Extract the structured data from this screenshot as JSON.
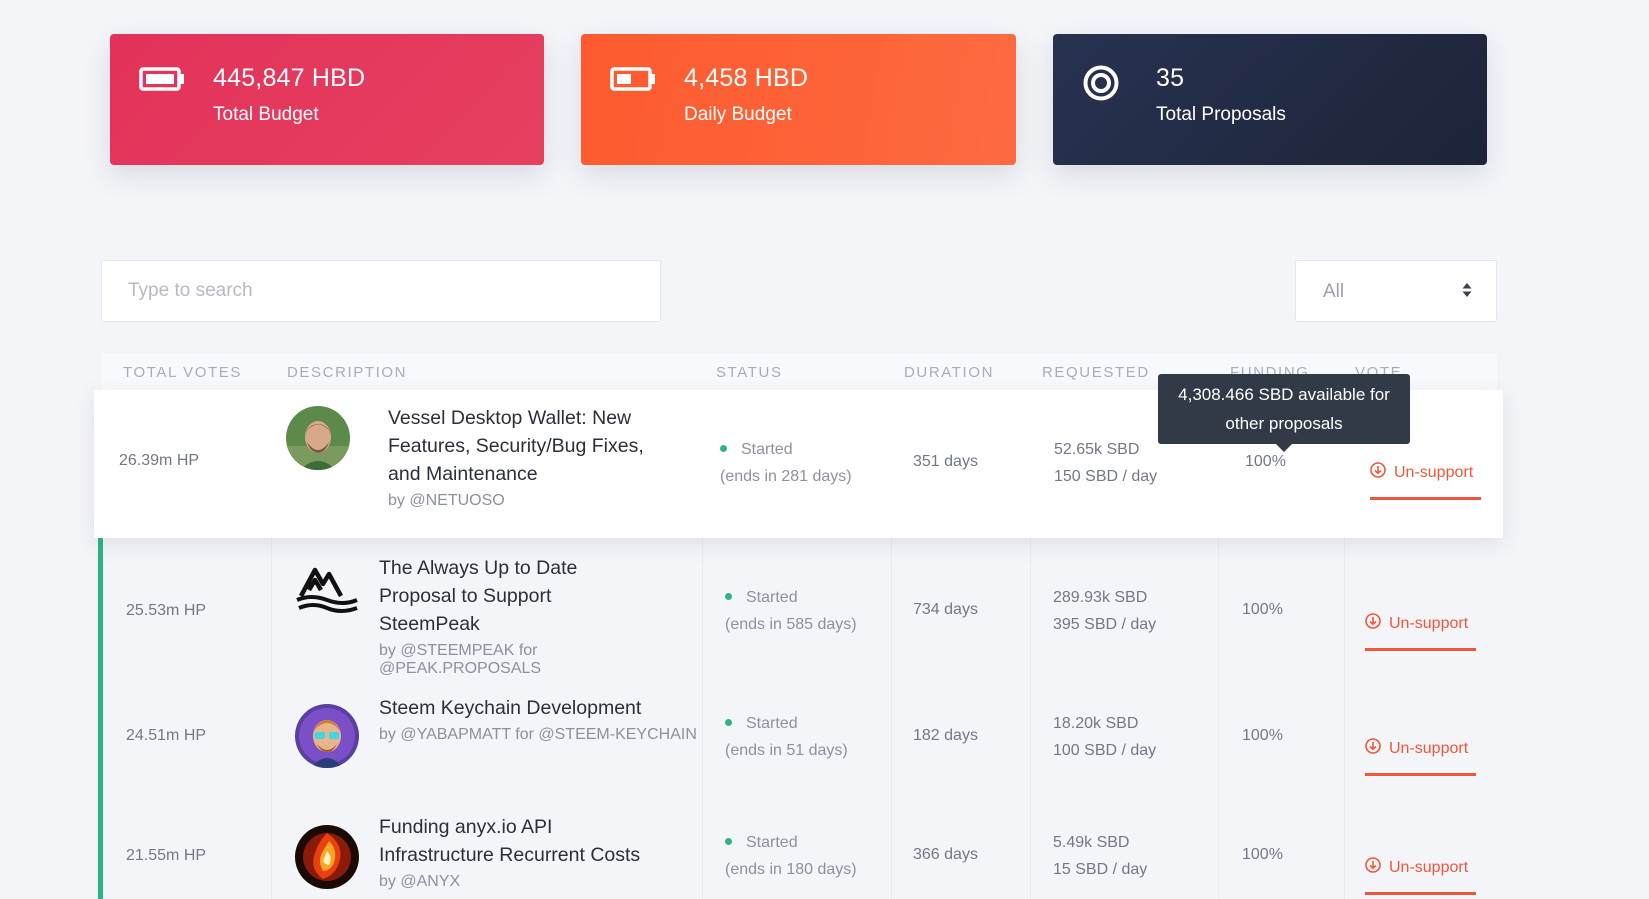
{
  "stats": {
    "total_budget": {
      "value": "445,847 HBD",
      "label": "Total Budget",
      "icon": "battery-full-icon",
      "color": "#e3325a"
    },
    "daily_budget": {
      "value": "4,458 HBD",
      "label": "Daily Budget",
      "icon": "battery-half-icon",
      "color": "#fd5a2f"
    },
    "total_proposals": {
      "value": "35",
      "label": "Total Proposals",
      "icon": "target-icon",
      "color": "#222a40"
    }
  },
  "search": {
    "placeholder": "Type to search",
    "value": ""
  },
  "filter": {
    "selected": "All"
  },
  "table": {
    "headers": [
      "TOTAL VOTES",
      "DESCRIPTION",
      "STATUS",
      "DURATION",
      "REQUESTED",
      "FUNDING",
      "VOTE"
    ],
    "rows": [
      {
        "votes": "26.39m HP",
        "title_lines": [
          "Vessel Desktop Wallet: New",
          "Features, Security/Bug Fixes,",
          "and Maintenance"
        ],
        "author": "by @NETUOSO",
        "status": "Started",
        "ends": "(ends in 281 days)",
        "duration": "351 days",
        "requested_total": "52.65k SBD",
        "requested_daily": "150 SBD / day",
        "funding": "100%",
        "vote_label": "Un-support"
      },
      {
        "votes": "25.53m HP",
        "title_lines": [
          "The Always Up to Date",
          "Proposal to Support",
          "SteemPeak"
        ],
        "author": "by @STEEMPEAK for @PEAK.PROPOSALS",
        "status": "Started",
        "ends": "(ends in 585 days)",
        "duration": "734 days",
        "requested_total": "289.93k SBD",
        "requested_daily": "395 SBD / day",
        "funding": "100%",
        "vote_label": "Un-support"
      },
      {
        "votes": "24.51m HP",
        "title_lines": [
          "Steem Keychain Development"
        ],
        "author": "by @YABAPMATT for @STEEM-KEYCHAIN",
        "status": "Started",
        "ends": "(ends in 51 days)",
        "duration": "182 days",
        "requested_total": "18.20k SBD",
        "requested_daily": "100 SBD / day",
        "funding": "100%",
        "vote_label": "Un-support"
      },
      {
        "votes": "21.55m HP",
        "title_lines": [
          "Funding anyx.io API",
          "Infrastructure Recurrent Costs"
        ],
        "author": "by @ANYX",
        "status": "Started",
        "ends": "(ends in 180 days)",
        "duration": "366 days",
        "requested_total": "5.49k SBD",
        "requested_daily": "15 SBD / day",
        "funding": "100%",
        "vote_label": "Un-support"
      }
    ]
  },
  "tooltip": {
    "lines": [
      "4,308.466 SBD available for",
      "other proposals"
    ]
  },
  "colors": {
    "accent_green": "#2eb483",
    "unsupport_red": "#f0573a",
    "tooltip_bg": "#323a47"
  }
}
